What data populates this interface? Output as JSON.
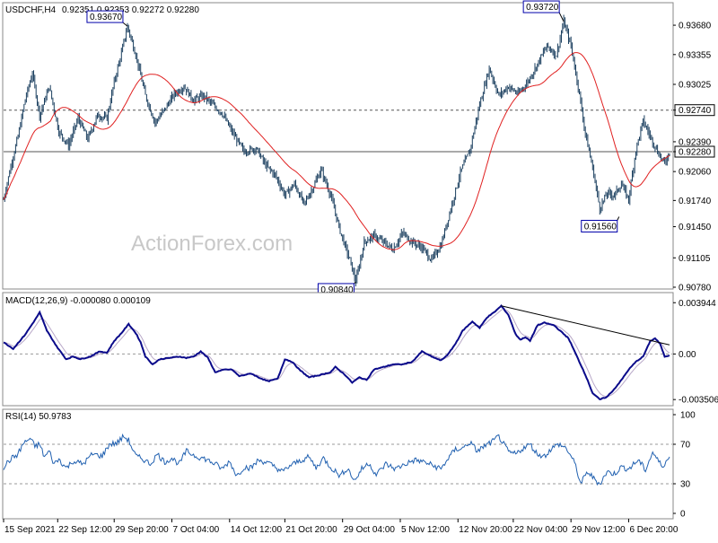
{
  "header": {
    "symbol": "USDCHF,H4",
    "ohlc": "0.92351 0.92353 0.92272 0.92280"
  },
  "watermark": "ActionForex.com",
  "colors": {
    "price": "#1b3f5f",
    "sma": "#e02020",
    "macd": "#0a0a8a",
    "signal": "#b8a8c8",
    "rsi": "#2060b0",
    "level_line": "#555555",
    "trendline": "#000000"
  },
  "chart_data": [
    {
      "type": "bar",
      "panel": "price",
      "title": "USDCHF,H4",
      "ohlc_label": "0.92351 0.92353 0.92272 0.92280",
      "ylim": [
        0.9078,
        0.938
      ],
      "y_ticks": [
        "0.93680",
        "0.93355",
        "0.93025",
        "0.92740",
        "0.92390",
        "0.92280",
        "0.92060",
        "0.91740",
        "0.91450",
        "0.91105",
        "0.90780"
      ],
      "x_ticks": [
        "15 Sep 2021",
        "22 Sep 12:00",
        "29 Sep 20:00",
        "7 Oct 04:00",
        "14 Oct 12:00",
        "21 Oct 20:00",
        "29 Oct 04:00",
        "5 Nov 12:00",
        "12 Nov 20:00",
        "22 Nov 04:00",
        "29 Nov 12:00",
        "6 Dec 20:00"
      ],
      "close_anchors": [
        [
          0,
          0.9175
        ],
        [
          6,
          0.9212
        ],
        [
          12,
          0.9245
        ],
        [
          18,
          0.9286
        ],
        [
          24,
          0.9315
        ],
        [
          30,
          0.9268
        ],
        [
          38,
          0.93
        ],
        [
          46,
          0.925
        ],
        [
          54,
          0.9235
        ],
        [
          62,
          0.9265
        ],
        [
          70,
          0.9242
        ],
        [
          78,
          0.9268
        ],
        [
          86,
          0.9265
        ],
        [
          92,
          0.9305
        ],
        [
          98,
          0.9337
        ],
        [
          103,
          0.9367
        ],
        [
          110,
          0.9335
        ],
        [
          118,
          0.929
        ],
        [
          126,
          0.926
        ],
        [
          134,
          0.9275
        ],
        [
          142,
          0.9292
        ],
        [
          150,
          0.93
        ],
        [
          158,
          0.9285
        ],
        [
          166,
          0.929
        ],
        [
          174,
          0.928
        ],
        [
          182,
          0.927
        ],
        [
          190,
          0.925
        ],
        [
          200,
          0.9228
        ],
        [
          210,
          0.9232
        ],
        [
          218,
          0.9213
        ],
        [
          226,
          0.9202
        ],
        [
          234,
          0.918
        ],
        [
          242,
          0.9192
        ],
        [
          250,
          0.917
        ],
        [
          258,
          0.919
        ],
        [
          264,
          0.9208
        ],
        [
          272,
          0.918
        ],
        [
          280,
          0.914
        ],
        [
          288,
          0.9108
        ],
        [
          293,
          0.9084
        ],
        [
          300,
          0.9128
        ],
        [
          308,
          0.9135
        ],
        [
          316,
          0.9128
        ],
        [
          324,
          0.912
        ],
        [
          332,
          0.9138
        ],
        [
          340,
          0.9128
        ],
        [
          348,
          0.9122
        ],
        [
          356,
          0.9108
        ],
        [
          364,
          0.9125
        ],
        [
          372,
          0.9165
        ],
        [
          380,
          0.9205
        ],
        [
          388,
          0.923
        ],
        [
          396,
          0.928
        ],
        [
          404,
          0.932
        ],
        [
          412,
          0.929
        ],
        [
          420,
          0.93
        ],
        [
          428,
          0.9292
        ],
        [
          436,
          0.9305
        ],
        [
          444,
          0.9325
        ],
        [
          452,
          0.9345
        ],
        [
          460,
          0.9335
        ],
        [
          466,
          0.9372
        ],
        [
          472,
          0.9345
        ],
        [
          478,
          0.93
        ],
        [
          484,
          0.9248
        ],
        [
          490,
          0.921
        ],
        [
          496,
          0.9165
        ],
        [
          502,
          0.9182
        ],
        [
          508,
          0.918
        ],
        [
          514,
          0.9192
        ],
        [
          520,
          0.9175
        ],
        [
          526,
          0.923
        ],
        [
          532,
          0.9262
        ],
        [
          538,
          0.9245
        ],
        [
          544,
          0.9228
        ],
        [
          550,
          0.9215
        ],
        [
          554,
          0.9228
        ]
      ],
      "series": [
        {
          "name": "SMA",
          "values": "derived from closes"
        }
      ],
      "annotations": [
        {
          "label": "0.93670",
          "x": 103,
          "y": 0.9367
        },
        {
          "label": "0.93720",
          "x": 466,
          "y": 0.9372
        },
        {
          "label": "0.90840",
          "x": 293,
          "y": 0.9084
        },
        {
          "label": "0.91560",
          "x": 512,
          "y": 0.9156
        }
      ],
      "level_labels": [
        {
          "label": "0.92740",
          "y": 0.9274,
          "dashed": true
        },
        {
          "label": "0.92280",
          "y": 0.9228,
          "dashed": false
        }
      ]
    },
    {
      "type": "line",
      "panel": "macd",
      "label": "MACD(12,26,9) -0.000080 0.000109",
      "ylim": [
        -0.0037,
        0.0041
      ],
      "y_ticks": [
        "0.003944",
        "0.00",
        "-0.003506"
      ],
      "anchors": [
        [
          0,
          0.0009
        ],
        [
          8,
          0.0004
        ],
        [
          18,
          0.0015
        ],
        [
          26,
          0.0026
        ],
        [
          30,
          0.0032
        ],
        [
          36,
          0.0018
        ],
        [
          44,
          0.0006
        ],
        [
          52,
          -0.0004
        ],
        [
          58,
          -0.0002
        ],
        [
          64,
          -0.0004
        ],
        [
          72,
          -0.0002
        ],
        [
          80,
          0.0002
        ],
        [
          86,
          0.0001
        ],
        [
          92,
          0.001
        ],
        [
          98,
          0.0016
        ],
        [
          104,
          0.0023
        ],
        [
          110,
          0.0016
        ],
        [
          114,
          0.0009
        ],
        [
          118,
          -0.0002
        ],
        [
          124,
          -0.0008
        ],
        [
          130,
          -0.0004
        ],
        [
          138,
          -0.0003
        ],
        [
          146,
          -0.0002
        ],
        [
          152,
          -0.0003
        ],
        [
          158,
          -0.0002
        ],
        [
          164,
          0.0002
        ],
        [
          170,
          -0.0003
        ],
        [
          176,
          -0.0014
        ],
        [
          184,
          -0.0012
        ],
        [
          190,
          -0.0012
        ],
        [
          196,
          -0.0017
        ],
        [
          206,
          -0.0015
        ],
        [
          212,
          -0.0018
        ],
        [
          220,
          -0.0021
        ],
        [
          228,
          -0.0019
        ],
        [
          234,
          -0.0004
        ],
        [
          240,
          -0.0006
        ],
        [
          246,
          -0.0012
        ],
        [
          254,
          -0.0018
        ],
        [
          264,
          -0.0016
        ],
        [
          272,
          -0.0014
        ],
        [
          276,
          -0.001
        ],
        [
          284,
          -0.0016
        ],
        [
          290,
          -0.0022
        ],
        [
          296,
          -0.0018
        ],
        [
          302,
          -0.002
        ],
        [
          308,
          -0.0012
        ],
        [
          316,
          -0.001
        ],
        [
          324,
          -0.0008
        ],
        [
          332,
          -0.0008
        ],
        [
          340,
          -0.0006
        ],
        [
          348,
          0.0002
        ],
        [
          356,
          -0.0002
        ],
        [
          364,
          -0.0005
        ],
        [
          370,
          0.0
        ],
        [
          376,
          0.0008
        ],
        [
          382,
          0.0018
        ],
        [
          390,
          0.0025
        ],
        [
          396,
          0.002
        ],
        [
          402,
          0.0028
        ],
        [
          408,
          0.0032
        ],
        [
          414,
          0.0037
        ],
        [
          420,
          0.003
        ],
        [
          426,
          0.0015
        ],
        [
          430,
          0.0011
        ],
        [
          434,
          0.0013
        ],
        [
          438,
          0.001
        ],
        [
          444,
          0.0022
        ],
        [
          450,
          0.0024
        ],
        [
          458,
          0.0022
        ],
        [
          464,
          0.0017
        ],
        [
          470,
          0.0012
        ],
        [
          478,
          -0.0004
        ],
        [
          484,
          -0.0016
        ],
        [
          490,
          -0.003
        ],
        [
          496,
          -0.0035
        ],
        [
          502,
          -0.0033
        ],
        [
          508,
          -0.0027
        ],
        [
          514,
          -0.002
        ],
        [
          520,
          -0.0012
        ],
        [
          526,
          -0.0006
        ],
        [
          532,
          -0.0002
        ],
        [
          538,
          0.001
        ],
        [
          542,
          0.0012
        ],
        [
          546,
          0.0008
        ],
        [
          550,
          -0.0002
        ],
        [
          554,
          -0.0001
        ]
      ],
      "trendline": [
        [
          414,
          0.0037
        ],
        [
          554,
          0.0007
        ]
      ],
      "level_line": 0.0
    },
    {
      "type": "line",
      "panel": "rsi",
      "label": "RSI(14) 50.9783",
      "ylim": [
        0,
        100
      ],
      "y_ticks": [
        "100",
        "70",
        "30",
        "0"
      ],
      "levels": [
        70,
        30
      ],
      "anchors": [
        [
          0,
          47
        ],
        [
          6,
          55
        ],
        [
          12,
          60
        ],
        [
          16,
          70
        ],
        [
          22,
          76
        ],
        [
          26,
          68
        ],
        [
          30,
          70
        ],
        [
          34,
          57
        ],
        [
          38,
          63
        ],
        [
          42,
          50
        ],
        [
          46,
          55
        ],
        [
          52,
          46
        ],
        [
          58,
          53
        ],
        [
          66,
          50
        ],
        [
          74,
          60
        ],
        [
          82,
          58
        ],
        [
          88,
          70
        ],
        [
          94,
          71
        ],
        [
          100,
          78
        ],
        [
          104,
          74
        ],
        [
          110,
          58
        ],
        [
          116,
          55
        ],
        [
          122,
          50
        ],
        [
          128,
          60
        ],
        [
          134,
          52
        ],
        [
          140,
          56
        ],
        [
          146,
          50
        ],
        [
          152,
          63
        ],
        [
          160,
          58
        ],
        [
          168,
          55
        ],
        [
          176,
          50
        ],
        [
          182,
          45
        ],
        [
          188,
          53
        ],
        [
          194,
          38
        ],
        [
          200,
          47
        ],
        [
          206,
          46
        ],
        [
          212,
          54
        ],
        [
          218,
          52
        ],
        [
          226,
          47
        ],
        [
          232,
          42
        ],
        [
          238,
          48
        ],
        [
          246,
          53
        ],
        [
          254,
          57
        ],
        [
          260,
          46
        ],
        [
          266,
          56
        ],
        [
          272,
          47
        ],
        [
          280,
          38
        ],
        [
          286,
          46
        ],
        [
          292,
          33
        ],
        [
          298,
          45
        ],
        [
          304,
          51
        ],
        [
          310,
          39
        ],
        [
          318,
          50
        ],
        [
          326,
          45
        ],
        [
          334,
          50
        ],
        [
          342,
          54
        ],
        [
          350,
          52
        ],
        [
          358,
          48
        ],
        [
          364,
          45
        ],
        [
          370,
          56
        ],
        [
          376,
          65
        ],
        [
          382,
          66
        ],
        [
          388,
          72
        ],
        [
          394,
          63
        ],
        [
          400,
          68
        ],
        [
          406,
          72
        ],
        [
          412,
          78
        ],
        [
          416,
          70
        ],
        [
          420,
          62
        ],
        [
          426,
          60
        ],
        [
          432,
          66
        ],
        [
          438,
          70
        ],
        [
          444,
          60
        ],
        [
          450,
          58
        ],
        [
          456,
          66
        ],
        [
          462,
          70
        ],
        [
          468,
          66
        ],
        [
          472,
          58
        ],
        [
          476,
          48
        ],
        [
          480,
          30
        ],
        [
          486,
          42
        ],
        [
          492,
          34
        ],
        [
          496,
          30
        ],
        [
          502,
          42
        ],
        [
          508,
          40
        ],
        [
          514,
          47
        ],
        [
          520,
          45
        ],
        [
          528,
          54
        ],
        [
          534,
          44
        ],
        [
          540,
          62
        ],
        [
          544,
          54
        ],
        [
          548,
          48
        ],
        [
          552,
          54
        ],
        [
          554,
          56
        ]
      ]
    }
  ]
}
